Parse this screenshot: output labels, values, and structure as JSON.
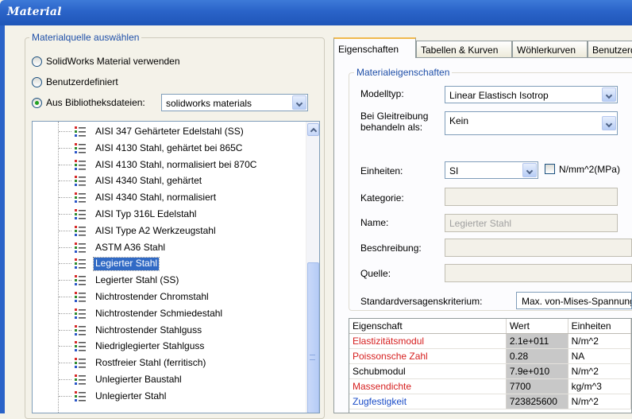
{
  "window": {
    "title": "Material"
  },
  "source": {
    "legend": "Materialquelle auswählen",
    "options": [
      {
        "label": "SolidWorks Material verwenden",
        "selected": false
      },
      {
        "label": "Benutzerdefiniert",
        "selected": false
      },
      {
        "label": "Aus Bibliotheksdateien:",
        "selected": true
      }
    ],
    "library_value": "solidworks materials"
  },
  "tree": {
    "items": [
      "AISI 347  Gehärteter Edelstahl (SS)",
      "AISI 4130 Stahl, gehärtet bei 865C",
      "AISI 4130 Stahl, normalisiert bei 870C",
      "AISI 4340 Stahl, gehärtet",
      "AISI 4340 Stahl, normalisiert",
      "AISI Typ 316L Edelstahl",
      "AISI Type A2 Werkzeugstahl",
      "ASTM A36 Stahl",
      "Legierter Stahl",
      "Legierter Stahl (SS)",
      "Nichtrostender Chromstahl",
      "Nichtrostender Schmiedestahl",
      "Nichtrostender Stahlguss",
      "Niedriglegierter Stahlguss",
      "Rostfreier Stahl (ferritisch)",
      "Unlegierter Baustahl",
      "Unlegierter Stahl"
    ],
    "selected_index": 8
  },
  "tabs": [
    "Eigenschaften",
    "Tabellen & Kurven",
    "Wöhlerkurven",
    "Benutzerdefiniert"
  ],
  "properties": {
    "legend": "Materialeigenschaften",
    "modeltyp_label": "Modelltyp:",
    "modeltyp_value": "Linear Elastisch Isotrop",
    "gleit_label_1": "Bei Gleitreibung",
    "gleit_label_2": "behandeln als:",
    "gleit_value": "Kein",
    "einheiten_label": "Einheiten:",
    "einheiten_value": "SI",
    "mpa_label": "N/mm^2(MPa)",
    "kategorie_label": "Kategorie:",
    "kategorie_value": "",
    "name_label": "Name:",
    "name_value": "Legierter Stahl",
    "beschreibung_label": "Beschreibung:",
    "beschreibung_value": "",
    "quelle_label": "Quelle:",
    "quelle_value": "",
    "kriterium_label": "Standardversagenskriterium:",
    "kriterium_value": "Max. von-Mises-Spannung"
  },
  "table": {
    "headers": [
      "Eigenschaft",
      "Wert",
      "Einheiten"
    ],
    "rows": [
      {
        "name": "Elastizitätsmodul",
        "value": "2.1e+011",
        "unit": "N/m^2",
        "color": "red"
      },
      {
        "name": "Poissonsche Zahl",
        "value": "0.28",
        "unit": "NA",
        "color": "red"
      },
      {
        "name": "Schubmodul",
        "value": "7.9e+010",
        "unit": "N/m^2",
        "color": "black"
      },
      {
        "name": "Massendichte",
        "value": "7700",
        "unit": "kg/m^3",
        "color": "red"
      },
      {
        "name": "Zugfestigkeit",
        "value": "723825600",
        "unit": "N/m^2",
        "color": "blue"
      }
    ]
  }
}
